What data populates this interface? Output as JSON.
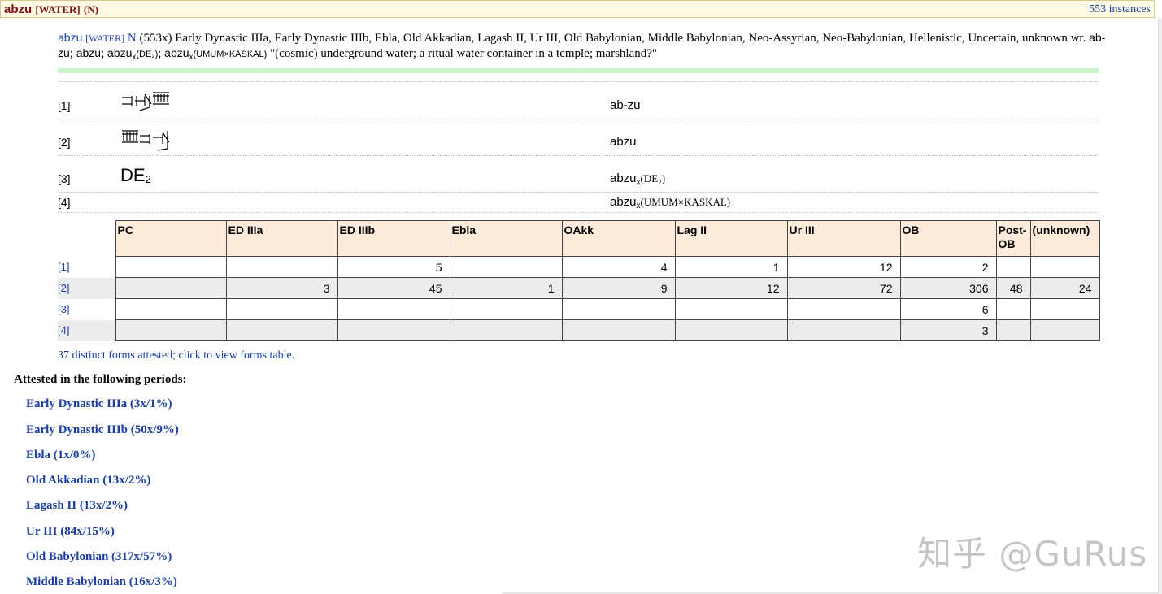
{
  "header": {
    "headword": "abzu",
    "guideword": "[WATER]",
    "pos": "(N)",
    "instances": "553 instances"
  },
  "summary": {
    "citation": "abzu",
    "guideword": "[WATER]",
    "pos": "N",
    "count_and_periods": "(553x) Early Dynastic IIIa, Early Dynastic IIIb, Ebla, Old Akkadian, Lagash II, Ur III, Old Babylonian, Middle Babylonian, Neo-Assyrian, Neo-Babylonian, Hellenistic, Uncertain, unknown wr.",
    "form1": "ab-zu",
    "form2": "abzu",
    "form3_base": "abzu",
    "form3_sub": "x",
    "form3_paren": "(DE₂)",
    "form4_base": "abzu",
    "form4_sub": "x",
    "form4_paren": "(UMUM×KASKAL)",
    "definition": "\"(cosmic) underground water; a ritual water container in a temple; marshland?\""
  },
  "forms": [
    {
      "num": "[1]",
      "translit": "ab-zu",
      "cuneiform": "𒀊𒍪"
    },
    {
      "num": "[2]",
      "translit": "abzu",
      "cuneiform": "𒍪𒀊"
    },
    {
      "num": "[3]",
      "sign_base": "DE",
      "sign_sub": "2",
      "translit_base": "abzu",
      "translit_sub": "x",
      "translit_paren": "(DE₂)"
    },
    {
      "num": "[4]",
      "translit_base": "abzu",
      "translit_sub": "x",
      "translit_paren": "(UMUM×KASKAL)"
    }
  ],
  "period_table": {
    "headers": [
      "PC",
      "ED IIIa",
      "ED IIIb",
      "Ebla",
      "OAkk",
      "Lag II",
      "Ur III",
      "OB",
      "Post-OB",
      "(unknown)"
    ],
    "rows": [
      {
        "label": "[1]",
        "values": [
          "",
          "",
          "5",
          "",
          "4",
          "1",
          "12",
          "2",
          "",
          ""
        ]
      },
      {
        "label": "[2]",
        "values": [
          "",
          "3",
          "45",
          "1",
          "9",
          "12",
          "72",
          "306",
          "48",
          "24"
        ]
      },
      {
        "label": "[3]",
        "values": [
          "",
          "",
          "",
          "",
          "",
          "",
          "",
          "6",
          "",
          ""
        ]
      },
      {
        "label": "[4]",
        "values": [
          "",
          "",
          "",
          "",
          "",
          "",
          "",
          "3",
          "",
          ""
        ]
      }
    ]
  },
  "forms_link": "37 distinct forms attested; click to view forms table.",
  "attested_heading": "Attested in the following periods:",
  "periods": [
    "Early Dynastic IIIa (3x/1%)",
    "Early Dynastic IIIb (50x/9%)",
    "Ebla (1x/0%)",
    "Old Akkadian (13x/2%)",
    "Lagash II (13x/2%)",
    "Ur III (84x/15%)",
    "Old Babylonian (317x/57%)",
    "Middle Babylonian (16x/3%)"
  ],
  "watermark": "知乎 @GuRus"
}
